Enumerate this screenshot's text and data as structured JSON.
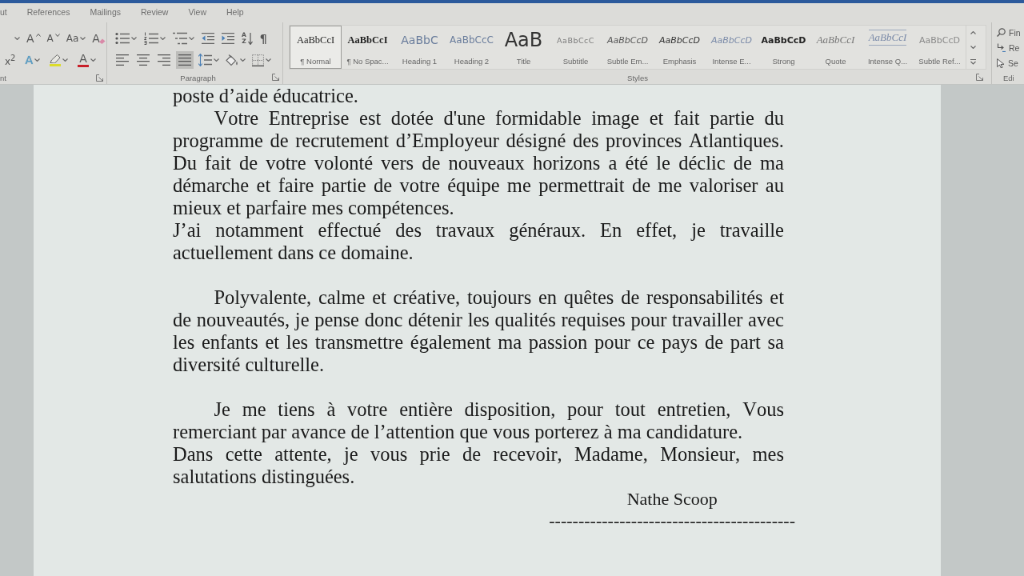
{
  "ribbon_tabs": [
    {
      "label": "ut",
      "selected": false
    },
    {
      "label": "References",
      "selected": false
    },
    {
      "label": "Mailings",
      "selected": false
    },
    {
      "label": "Review",
      "selected": false
    },
    {
      "label": "View",
      "selected": false
    },
    {
      "label": "Help",
      "selected": false
    }
  ],
  "font_group": {
    "label": "nt",
    "rows": [
      [
        {
          "kind": "size-menu",
          "menu": true
        },
        {
          "kind": "grow",
          "glyph": "A",
          "menu": false
        },
        {
          "kind": "shrink",
          "glyph": "A",
          "menu": false
        },
        {
          "kind": "case",
          "glyph": "Aa",
          "menu": true
        },
        {
          "kind": "clear",
          "glyph": "A",
          "menu": false
        }
      ],
      [
        {
          "kind": "superscript",
          "glyph": "x$^{2}$",
          "menu": false
        },
        {
          "kind": "effects",
          "glyph": "A",
          "menu": true
        },
        {
          "kind": "highlight",
          "menu": true,
          "color": "#dcdc2a"
        },
        {
          "kind": "font-color",
          "glyph": "A",
          "menu": true,
          "color": "#c8202a"
        }
      ]
    ]
  },
  "paragraph_group": {
    "label": "Paragraph",
    "list_tools": [
      {
        "kind": "bullets",
        "menu": true
      },
      {
        "kind": "numbering",
        "menu": true
      },
      {
        "kind": "multilevel",
        "menu": true
      },
      {
        "kind": "outdent",
        "menu": false
      },
      {
        "kind": "indent",
        "menu": false
      },
      {
        "kind": "sort",
        "glyphs": [
          "A",
          "Z"
        ],
        "menu": false
      },
      {
        "kind": "pilcrow",
        "glyph": "¶",
        "menu": false
      }
    ],
    "alignment": [
      {
        "kind": "align-left",
        "selected": false
      },
      {
        "kind": "align-center",
        "selected": false
      },
      {
        "kind": "align-right",
        "selected": false
      },
      {
        "kind": "justify",
        "selected": true
      }
    ],
    "spacing_tools": [
      {
        "kind": "line-spacing",
        "menu": true
      },
      {
        "kind": "shading",
        "menu": true
      },
      {
        "kind": "borders",
        "menu": true
      }
    ]
  },
  "styles_group": {
    "label": "Styles",
    "styles": [
      {
        "kind": "normal",
        "preview": "AaBbCcI",
        "name": "¶ Normal",
        "selected": true
      },
      {
        "kind": "no-spacing",
        "preview": "AaBbCcI",
        "name": "¶ No Spac...",
        "selected": false
      },
      {
        "kind": "heading1",
        "preview": "AaBbC",
        "name": "Heading 1",
        "selected": false
      },
      {
        "kind": "heading2",
        "preview": "AaBbCcC",
        "name": "Heading 2",
        "selected": false
      },
      {
        "kind": "title",
        "preview": "AaB",
        "name": "Title",
        "selected": false
      },
      {
        "kind": "subtitle",
        "preview": "AaBbCcC",
        "name": "Subtitle",
        "selected": false
      },
      {
        "kind": "subtle-emphasis",
        "preview": "AaBbCcD",
        "name": "Subtle Em...",
        "selected": false
      },
      {
        "kind": "emphasis",
        "preview": "AaBbCcD",
        "name": "Emphasis",
        "selected": false
      },
      {
        "kind": "intense-emphasis",
        "preview": "AaBbCcD",
        "name": "Intense E...",
        "selected": false
      },
      {
        "kind": "strong",
        "preview": "AaBbCcD",
        "name": "Strong",
        "selected": false
      },
      {
        "kind": "quote",
        "preview": "AaBbCcI",
        "name": "Quote",
        "selected": false
      },
      {
        "kind": "intense-quote",
        "preview": "AaBbCcI",
        "name": "Intense Q...",
        "selected": false
      },
      {
        "kind": "subtle-reference",
        "preview": "AaBbCcD",
        "name": "Subtle Ref...",
        "selected": false
      }
    ]
  },
  "editing_group": {
    "label": "Edi",
    "items": [
      {
        "kind": "find",
        "label": "Fin"
      },
      {
        "kind": "replace",
        "label": "Re"
      },
      {
        "kind": "select",
        "label": "Se"
      }
    ]
  },
  "document": {
    "sections": [
      {
        "paragraphs": [
          {
            "text": "poste d’aide éducatrice.",
            "indented": false
          },
          {
            "text": "Votre Entreprise est dotée d'une formidable image et fait partie du programme de recrutement d’Employeur désigné des provinces Atlantiques. Du fait de votre volonté vers de nouveaux horizons a été le déclic de ma démarche et faire partie de votre équipe me permettrait de me valoriser au mieux et parfaire mes compétences.",
            "indented": true
          },
          {
            "text": "J’ai notamment effectué des travaux généraux. En effet, je travaille actuellement dans ce domaine.",
            "indented": false
          }
        ]
      },
      {
        "paragraphs": [
          {
            "text": "Polyvalente, calme et créative, toujours en quêtes de responsabilités et de nouveautés, je pense donc détenir les qualités requises pour travailler avec les enfants et les transmettre également ma passion pour ce pays de part sa diversité culturelle.",
            "indented": true
          }
        ]
      },
      {
        "paragraphs": [
          {
            "text": "Je me tiens à votre entière disposition, pour tout entretien, Vous remerciant par avance de l’attention que vous porterez à ma candidature.",
            "indented": true
          },
          {
            "text": "Dans cette attente, je vous prie de recevoir, Madame, Monsieur, mes salutations distinguées.",
            "indented": false
          }
        ]
      }
    ],
    "signature": {
      "name": "Nathe Scoop",
      "line": "------------------------------------------"
    }
  }
}
